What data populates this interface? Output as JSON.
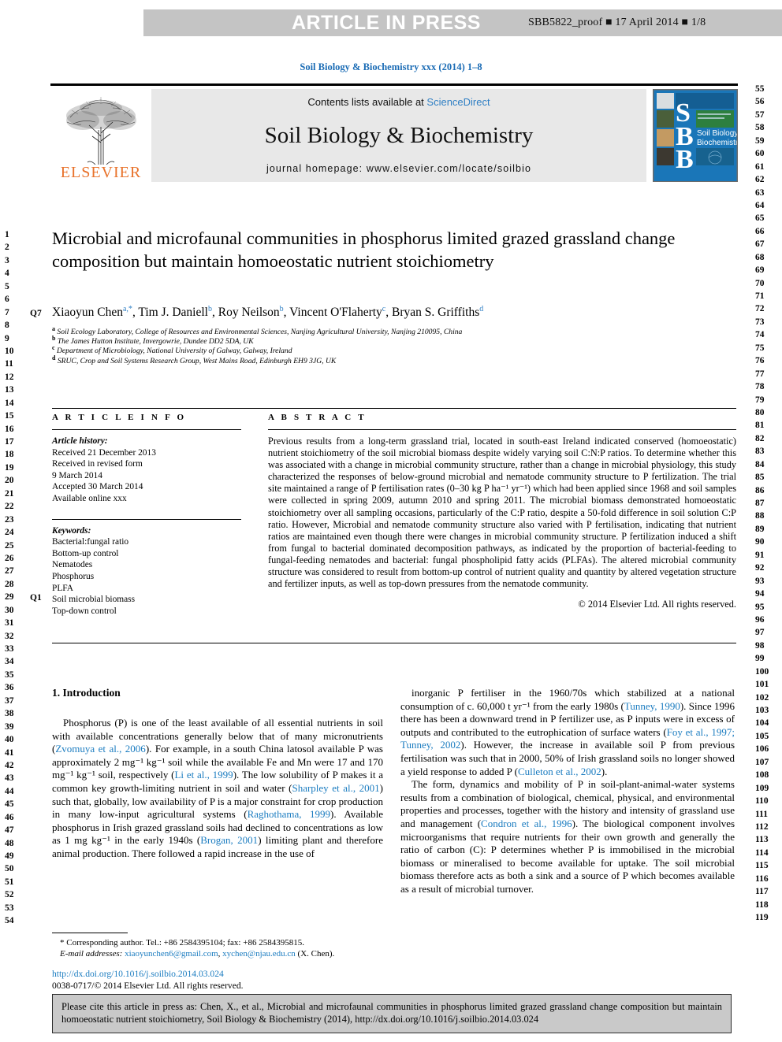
{
  "banner": {
    "title": "ARTICLE IN PRESS",
    "proof": "SBB5822_proof ■ 17 April 2014 ■ 1/8"
  },
  "journal_ref": "Soil Biology & Biochemistry xxx (2014) 1–8",
  "masthead": {
    "contents_prefix": "Contents lists available at ",
    "contents_link": "ScienceDirect",
    "journal_name": "Soil Biology & Biochemistry",
    "homepage": "journal homepage: www.elsevier.com/locate/soilbio",
    "publisher": "ELSEVIER",
    "cover_letters": [
      "S",
      "B",
      "B"
    ],
    "cover_title_line1": "Soil Biology &",
    "cover_title_line2": "Biochemistry"
  },
  "article": {
    "title": "Microbial and microfaunal communities in phosphorus limited grazed grassland change composition but maintain homoeostatic nutrient stoichiometry",
    "authors_html": "Xiaoyun Chen<sup>a,*</sup>, Tim J. Daniell<sup>b</sup>, Roy Neilson<sup>b</sup>, Vincent O'Flaherty<sup>c</sup>, Bryan S. Griffiths<sup>d</sup>",
    "affiliations": [
      "Soil Ecology Laboratory, College of Resources and Environmental Sciences, Nanjing Agricultural University, Nanjing 210095, China",
      "The James Hutton Institute, Invergowrie, Dundee DD2 5DA, UK",
      "Department of Microbiology, National University of Galway, Galway, Ireland",
      "SRUC, Crop and Soil Systems Research Group, West Mains Road, Edinburgh EH9 3JG, UK"
    ],
    "affiliation_marks": [
      "a",
      "b",
      "c",
      "d"
    ]
  },
  "info": {
    "heading": "A R T I C L E   I N F O",
    "history_label": "Article history:",
    "history": [
      "Received 21 December 2013",
      "Received in revised form",
      "9 March 2014",
      "Accepted 30 March 2014",
      "Available online xxx"
    ],
    "keywords_label": "Keywords:",
    "keywords": [
      "Bacterial:fungal ratio",
      "Bottom-up control",
      "Nematodes",
      "Phosphorus",
      "PLFA",
      "Soil microbial biomass",
      "Top-down control"
    ]
  },
  "abstract": {
    "heading": "A B S T R A C T",
    "text": "Previous results from a long-term grassland trial, located in south-east Ireland indicated conserved (homoeostatic) nutrient stoichiometry of the soil microbial biomass despite widely varying soil C:N:P ratios. To determine whether this was associated with a change in microbial community structure, rather than a change in microbial physiology, this study characterized the responses of below-ground microbial and nematode community structure to P fertilization. The trial site maintained a range of P fertilisation rates (0–30 kg P ha⁻¹ yr⁻¹) which had been applied since 1968 and soil samples were collected in spring 2009, autumn 2010 and spring 2011. The microbial biomass demonstrated homoeostatic stoichiometry over all sampling occasions, particularly of the C:P ratio, despite a 50-fold difference in soil solution C:P ratio. However, Microbial and nematode community structure also varied with P fertilisation, indicating that nutrient ratios are maintained even though there were changes in microbial community structure. P fertilization induced a shift from fungal to bacterial dominated decomposition pathways, as indicated by the proportion of bacterial-feeding to fungal-feeding nematodes and bacterial: fungal phospholipid fatty acids (PLFAs). The altered microbial community structure was considered to result from bottom-up control of nutrient quality and quantity by altered vegetation structure and fertilizer inputs, as well as top-down pressures from the nematode community.",
    "copyright": "© 2014 Elsevier Ltd. All rights reserved."
  },
  "body": {
    "intro_heading": "1. Introduction",
    "left_paragraph_1": "Phosphorus (P) is one of the least available of all essential nutrients in soil with available concentrations generally below that of many micronutrients (Zvomuya et al., 2006). For example, in a south China latosol available P was approximately 2 mg⁻¹ kg⁻¹ soil while the available Fe and Mn were 17 and 170 mg⁻¹ kg⁻¹ soil, respectively (Li et al., 1999). The low solubility of P makes it a common key growth-limiting nutrient in soil and water (Sharpley et al., 2001) such that, globally, low availability of P is a major constraint for crop production in many low-input agricultural systems (Raghothama, 1999). Available phosphorus in Irish grazed grassland soils had declined to concentrations as low as 1 mg kg⁻¹ in the early 1940s (Brogan, 2001) limiting plant and therefore animal production. There followed a rapid increase in the use of",
    "right_paragraph_1": "inorganic P fertiliser in the 1960/70s which stabilized at a national consumption of c. 60,000 t yr⁻¹ from the early 1980s (Tunney, 1990). Since 1996 there has been a downward trend in P fertilizer use, as P inputs were in excess of outputs and contributed to the eutrophication of surface waters (Foy et al., 1997; Tunney, 2002). However, the increase in available soil P from previous fertilisation was such that in 2000, 50% of Irish grassland soils no longer showed a yield response to added P (Culleton et al., 2002).",
    "right_paragraph_2": "The form, dynamics and mobility of P in soil-plant-animal-water systems results from a combination of biological, chemical, physical, and environmental properties and processes, together with the history and intensity of grassland use and management (Condron et al., 1996). The biological component involves microorganisms that require nutrients for their own growth and generally the ratio of carbon (C): P determines whether P is immobilised in the microbial biomass or mineralised to become available for uptake. The soil microbial biomass therefore acts as both a sink and a source of P which becomes available as a result of microbial turnover."
  },
  "footnote": {
    "corresponding": "* Corresponding author. Tel.: +86 2584395104; fax: +86 2584395815.",
    "email_label": "E-mail addresses:",
    "email_1": "xiaoyunchen6@gmail.com",
    "email_2": "xychen@njau.edu.cn",
    "email_suffix": "(X. Chen).",
    "doi": "http://dx.doi.org/10.1016/j.soilbio.2014.03.024",
    "issn_line": "0038-0717/© 2014 Elsevier Ltd. All rights reserved."
  },
  "cite_box": {
    "text": "Please cite this article in press as: Chen, X., et al., Microbial and microfaunal communities in phosphorus limited grazed grassland change composition but maintain homoeostatic nutrient stoichiometry, Soil Biology & Biochemistry (2014), http://dx.doi.org/10.1016/j.soilbio.2014.03.024"
  },
  "line_numbers": {
    "left_start": 1,
    "left_end": 54,
    "right_start": 55,
    "right_end": 119,
    "query_marks": [
      "Q7",
      "Q1"
    ]
  },
  "colors": {
    "link": "#1b7cc0",
    "banner_bg": "#c4c4c4",
    "contents_bg": "#e8e8e8",
    "elsevier_orange": "#e8722b",
    "cover_blue": "#1a76b8",
    "cite_bg": "#c9c9c9"
  }
}
